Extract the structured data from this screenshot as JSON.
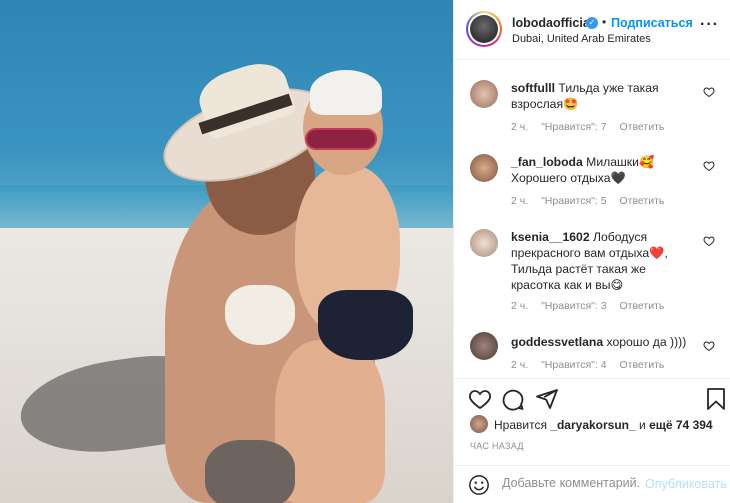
{
  "post": {
    "username": "lobodaofficial",
    "verified": true,
    "follow_label": "Подписаться",
    "location": "Dubai, United Arab Emirates",
    "separator": "•"
  },
  "comments": [
    {
      "user": "softfulll",
      "text": "Тильда уже такая взрослая🤩",
      "time": "2 ч.",
      "likes": "\"Нравится\": 7",
      "reply": "Ответить",
      "avatar_color": "#c89a86"
    },
    {
      "user": "_fan_loboda",
      "text": "Милашки🥰 Хорошего отдыха🖤",
      "time": "2 ч.",
      "likes": "\"Нравится\": 5",
      "reply": "Ответить",
      "avatar_color": "#a87a60"
    },
    {
      "user": "ksenia__1602",
      "text": "Лободуся прекрасного вам отдыха❤️, Тильда растёт такая же красотка как и вы😋",
      "time": "2 ч.",
      "likes": "\"Нравится\": 3",
      "reply": "Ответить",
      "avatar_color": "#d8c2b0"
    },
    {
      "user": "goddessvetlana",
      "text": "хорошо да ))))",
      "time": "2 ч.",
      "likes": "\"Нравится\": 4",
      "reply": "Ответить",
      "avatar_color": "#6e5a55"
    }
  ],
  "likes": {
    "prefix": "Нравится",
    "user": "_daryakorsun_",
    "middle": "и",
    "count": "ещё 74 394"
  },
  "time_ago": "ЧАС НАЗАД",
  "add_comment": {
    "placeholder": "Добавьте комментарий...",
    "publish_label": "Опубликовать"
  },
  "icons": [
    "like-icon",
    "comment-icon",
    "share-icon",
    "save-icon",
    "emoji-icon",
    "more-icon",
    "verified-icon"
  ]
}
